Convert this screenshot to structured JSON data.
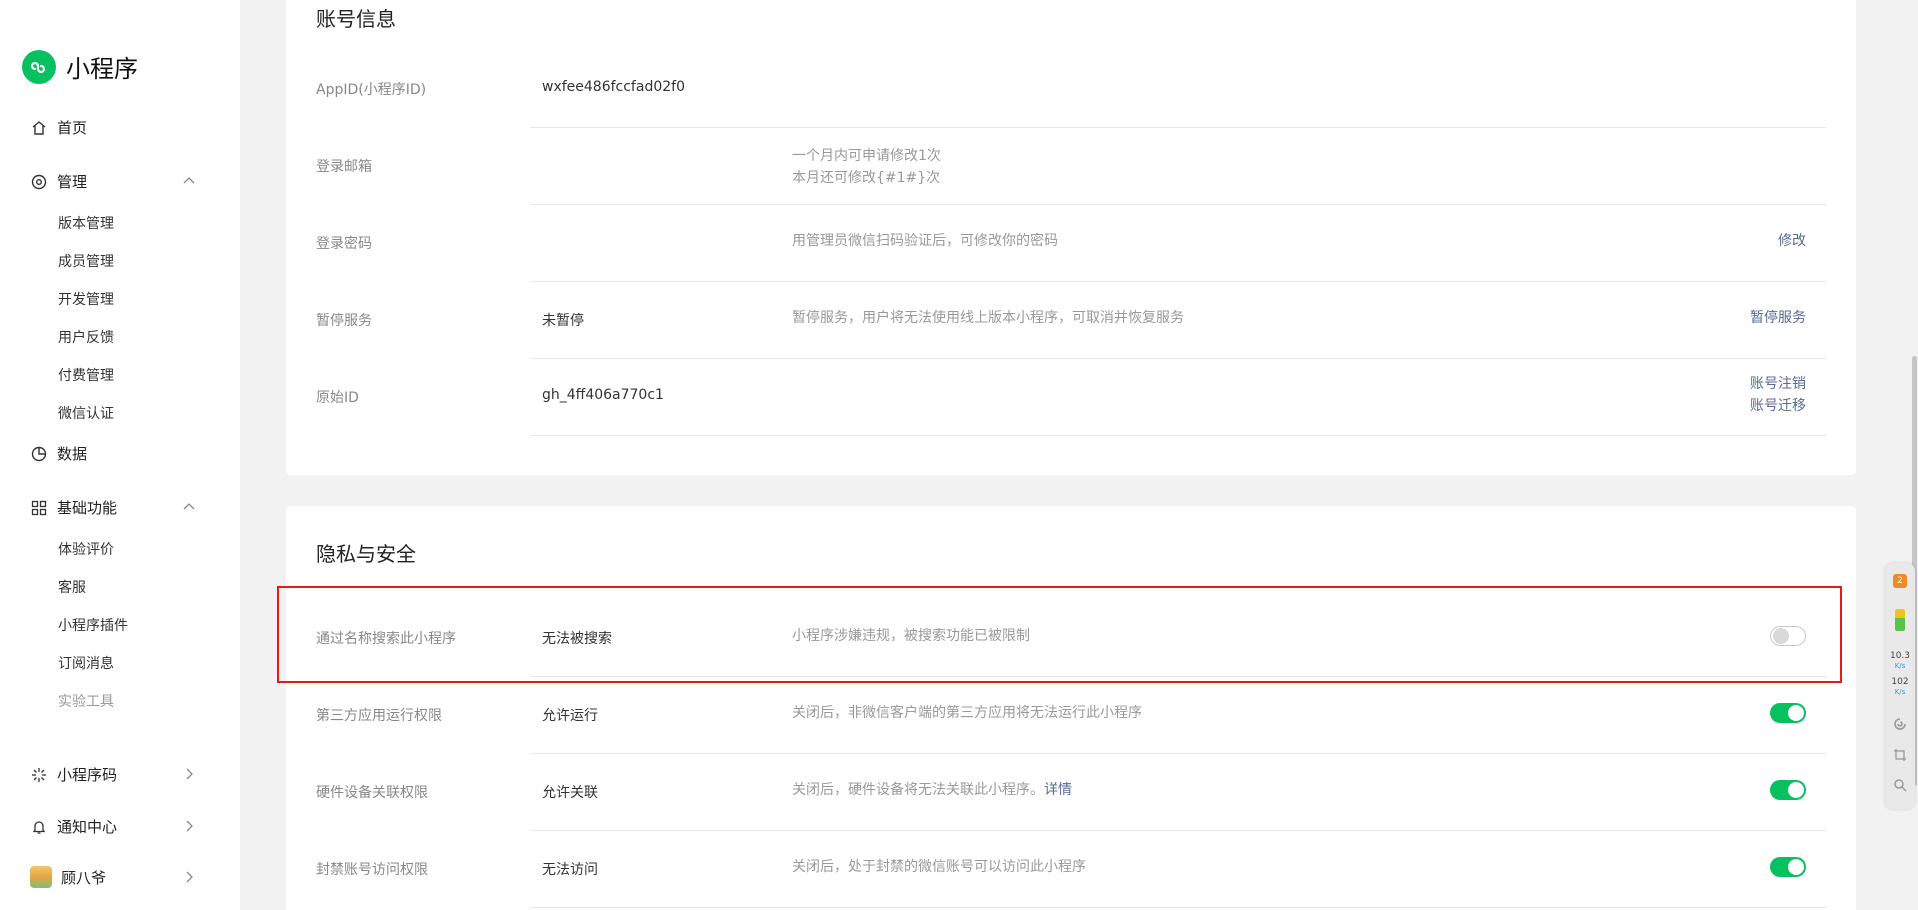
{
  "brand": {
    "name": "小程序",
    "accent": "#07c160"
  },
  "sidebar": {
    "home": "首页",
    "manage": {
      "label": "管理",
      "items": [
        "版本管理",
        "成员管理",
        "开发管理",
        "用户反馈",
        "付费管理",
        "微信认证"
      ]
    },
    "data": "数据",
    "basic": {
      "label": "基础功能",
      "items": [
        "体验评价",
        "客服",
        "小程序插件",
        "订阅消息",
        "实验工具"
      ]
    },
    "qrcode": "小程序码",
    "notify": "通知中心",
    "user": "顾八爷"
  },
  "account": {
    "title": "账号信息",
    "appid": {
      "label": "AppID(小程序ID)",
      "value": "wxfee486fccfad02f0"
    },
    "email": {
      "label": "登录邮箱",
      "desc_line1": "一个月内可申请修改1次",
      "desc_line2": "本月还可修改{#1#}次"
    },
    "password": {
      "label": "登录密码",
      "desc": "用管理员微信扫码验证后，可修改你的密码",
      "action": "修改"
    },
    "suspend": {
      "label": "暂停服务",
      "value": "未暂停",
      "desc": "暂停服务，用户将无法使用线上版本小程序，可取消并恢复服务",
      "action": "暂停服务"
    },
    "origin": {
      "label": "原始ID",
      "value": "gh_4ff406a770c1",
      "action1": "账号注销",
      "action2": "账号迁移"
    }
  },
  "privacy": {
    "title": "隐私与安全",
    "search": {
      "label": "通过名称搜索此小程序",
      "value": "无法被搜索",
      "desc": "小程序涉嫌违规，被搜索功能已被限制",
      "enabled": false
    },
    "thirdparty": {
      "label": "第三方应用运行权限",
      "value": "允许运行",
      "desc": "关闭后，非微信客户端的第三方应用将无法运行此小程序",
      "enabled": true
    },
    "hardware": {
      "label": "硬件设备关联权限",
      "value": "允许关联",
      "desc": "关闭后，硬件设备将无法关联此小程序。",
      "link": "详情",
      "enabled": true
    },
    "banned": {
      "label": "封禁账号访问权限",
      "value": "无法访问",
      "desc": "关闭后，处于封禁的微信账号可以访问此小程序",
      "enabled": true
    }
  },
  "widget": {
    "badge": "2",
    "upload": "10.3",
    "download": "102",
    "unit": "K/s"
  }
}
